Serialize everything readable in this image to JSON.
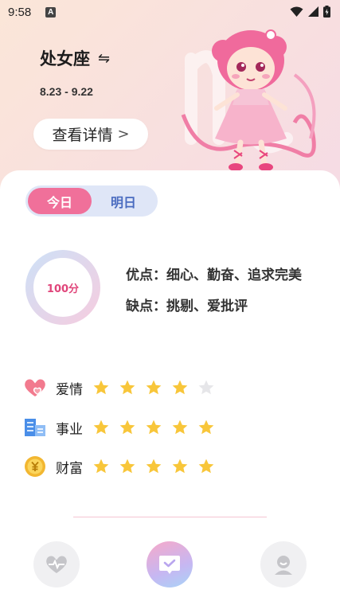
{
  "status_bar": {
    "time": "9:58",
    "notification_letter": "A"
  },
  "header": {
    "sign_name": "处女座",
    "date_range": "8.23 - 9.22",
    "detail_button_label": "查看详情"
  },
  "tabs": [
    {
      "label": "今日",
      "active": true
    },
    {
      "label": "明日",
      "active": false
    }
  ],
  "score": {
    "label": "100分",
    "value": 100,
    "max": 100
  },
  "traits": {
    "pros": "优点：细心、勤奋、追求完美",
    "cons": "缺点：挑剔、爱批评"
  },
  "fortunes": [
    {
      "label": "爱情",
      "icon": "heart-icon",
      "stars": 4,
      "max": 5
    },
    {
      "label": "事业",
      "icon": "buildings-icon",
      "stars": 5,
      "max": 5
    },
    {
      "label": "财富",
      "icon": "coin-icon",
      "stars": 5,
      "max": 5
    }
  ],
  "bottom_nav": [
    {
      "icon": "heart-pulse-icon",
      "active": false
    },
    {
      "icon": "check-chat-icon",
      "active": true
    },
    {
      "icon": "profile-icon",
      "active": false
    }
  ],
  "colors": {
    "accent_pink": "#f0709a",
    "tab_bg": "#dfe6f7",
    "tab_inactive_text": "#4a6cc0",
    "star_filled": "#f8c63a",
    "star_empty": "#e6e6e9",
    "score_text": "#e0457a"
  }
}
